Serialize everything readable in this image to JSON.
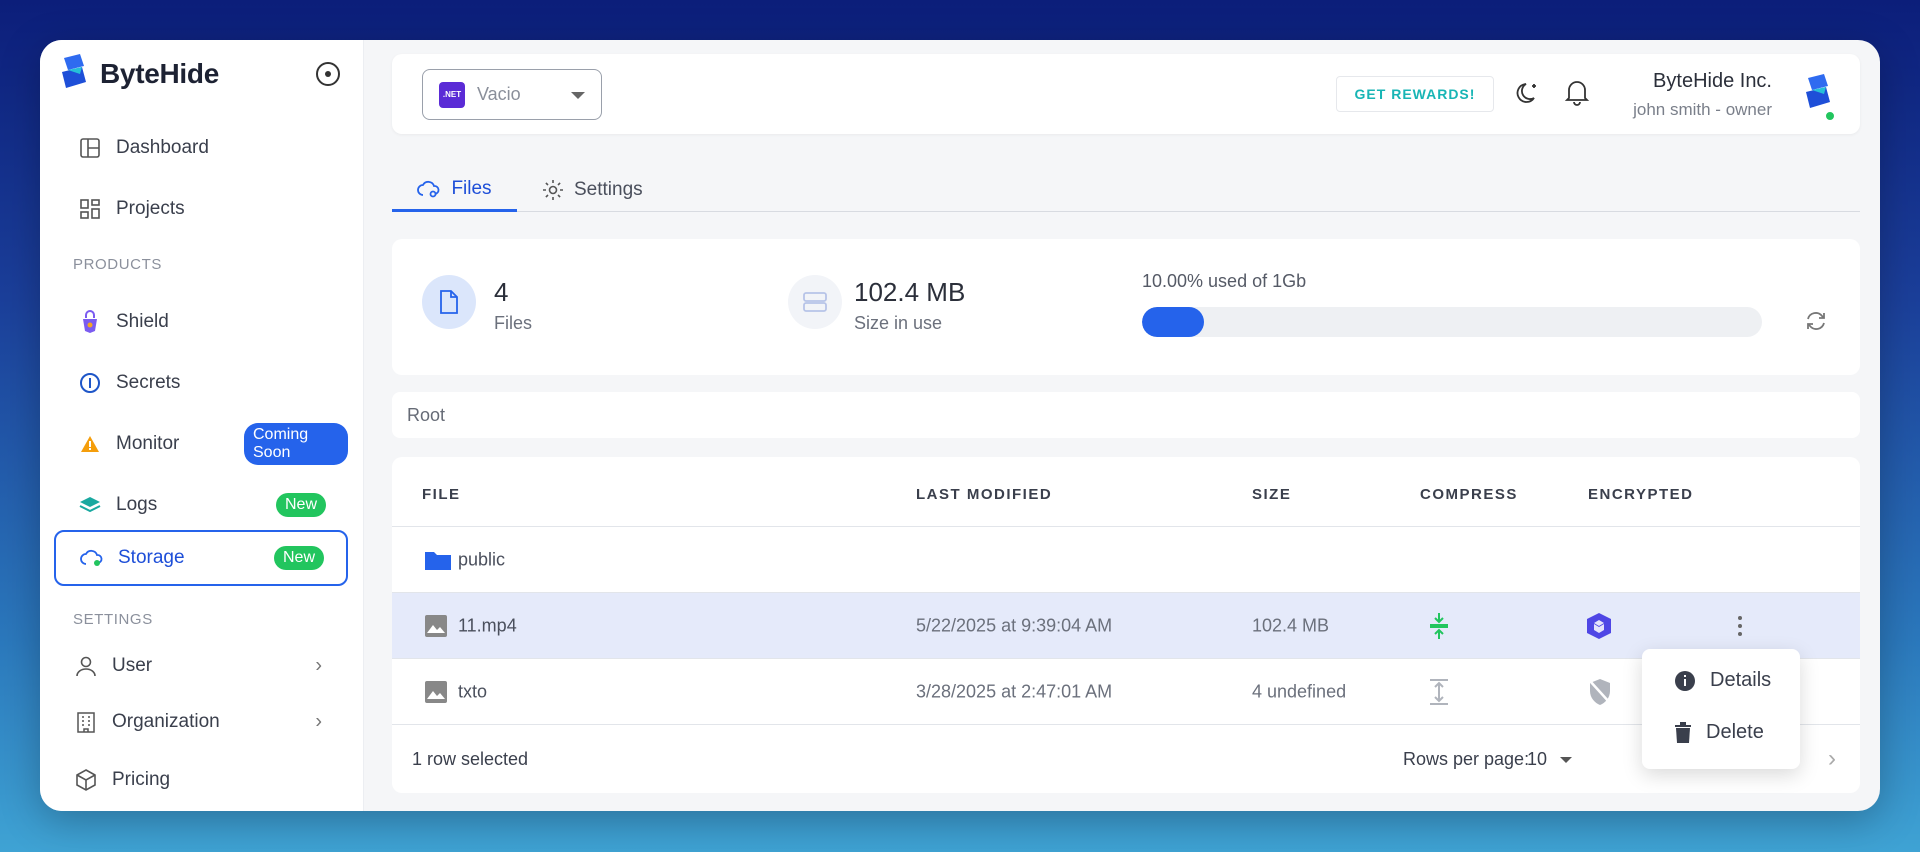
{
  "brand": {
    "name": "ByteHide"
  },
  "sidebar": {
    "items": [
      {
        "label": "Dashboard"
      },
      {
        "label": "Projects"
      }
    ],
    "products_label": "PRODUCTS",
    "products": [
      {
        "label": "Shield"
      },
      {
        "label": "Secrets"
      },
      {
        "label": "Monitor",
        "badge": "Coming Soon"
      },
      {
        "label": "Logs",
        "badge": "New"
      },
      {
        "label": "Storage",
        "badge": "New"
      }
    ],
    "settings_label": "SETTINGS",
    "settings": [
      {
        "label": "User"
      },
      {
        "label": "Organization"
      },
      {
        "label": "Pricing"
      }
    ]
  },
  "header": {
    "project_badge": ".NET",
    "project_name": "Vacio",
    "rewards_label": "GET REWARDS!",
    "org_name": "ByteHide Inc.",
    "org_user": "john smith - owner"
  },
  "tabs": [
    {
      "label": "Files"
    },
    {
      "label": "Settings"
    }
  ],
  "stats": {
    "files_count": "4",
    "files_label": "Files",
    "size_value": "102.4 MB",
    "size_label": "Size in use",
    "usage_label": "10.00% used of 1Gb",
    "usage_fraction": 0.1
  },
  "breadcrumb": {
    "path": "Root"
  },
  "table": {
    "columns": [
      "FILE",
      "LAST MODIFIED",
      "SIZE",
      "COMPRESS",
      "ENCRYPTED"
    ],
    "rows": [
      {
        "name": "public",
        "type": "folder",
        "modified": "",
        "size": ""
      },
      {
        "name": "11.mp4",
        "type": "file",
        "modified": "5/22/2025 at 9:39:04 AM",
        "size": "102.4 MB",
        "compressed": true,
        "encrypted": true,
        "selected": true
      },
      {
        "name": "txto",
        "type": "file",
        "modified": "3/28/2025 at 2:47:01 AM",
        "size": "4 undefined",
        "compressed": false,
        "encrypted": false
      }
    ],
    "footer": {
      "selection_text": "1 row selected",
      "rows_per_page_label": "Rows per page:",
      "rows_per_page_value": "10"
    }
  },
  "context_menu": {
    "items": [
      {
        "label": "Details"
      },
      {
        "label": "Delete"
      }
    ]
  },
  "colors": {
    "accent": "#2563eb",
    "success": "#22c55e",
    "rewards": "#18b5b5"
  }
}
